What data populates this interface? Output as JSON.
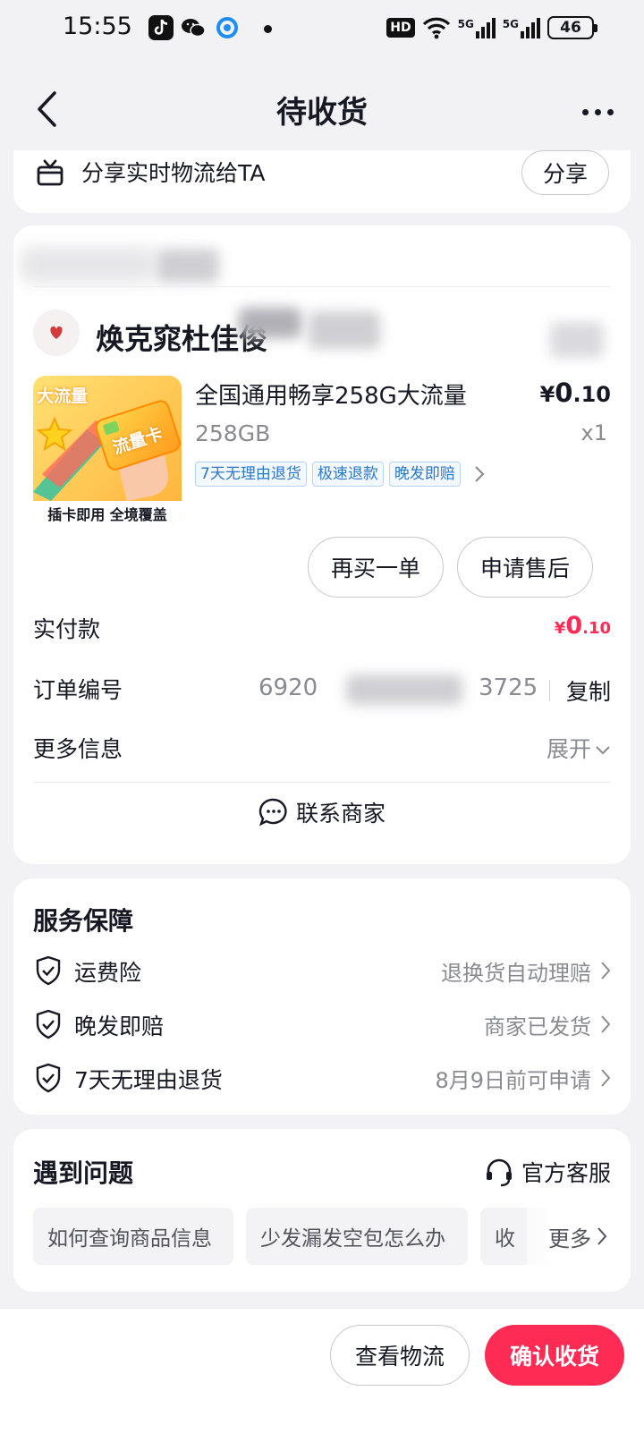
{
  "status_bar": {
    "time": "15:55",
    "apps": [
      "tiktok-icon",
      "wechat-icon",
      "browser-icon"
    ],
    "hd_label": "HD",
    "net1": "5G",
    "net2": "5G",
    "battery": "46"
  },
  "nav": {
    "title": "待收货"
  },
  "share": {
    "text": "分享实时物流给TA",
    "button": "分享"
  },
  "order": {
    "shop_name": "焕克窕杜佳俊",
    "product": {
      "image_top_text": "大流量",
      "image_card_text": "流量卡",
      "image_caption": "插卡即用 全境覆盖",
      "title": "全国通用畅享258G大流量",
      "price_symbol": "¥",
      "price_int": "0",
      "price_dec": ".10",
      "spec": "258GB",
      "qty": "x1",
      "tags": [
        "7天无理由退货",
        "极速退款",
        "晚发即赔"
      ]
    },
    "buttons": {
      "rebuy": "再买一单",
      "after_sale": "申请售后"
    },
    "paid": {
      "label": "实付款",
      "symbol": "¥",
      "int": "0",
      "dec": ".10"
    },
    "order_no": {
      "label": "订单编号",
      "prefix": "6920",
      "suffix": "3725",
      "copy": "复制"
    },
    "more_info": {
      "label": "更多信息",
      "value": "展开"
    },
    "contact": "联系商家"
  },
  "service": {
    "title": "服务保障",
    "items": [
      {
        "label": "运费险",
        "value": "退换货自动理赔"
      },
      {
        "label": "晚发即赔",
        "value": "商家已发货"
      },
      {
        "label": "7天无理由退货",
        "value": "8月9日前可申请"
      }
    ]
  },
  "problems": {
    "title": "遇到问题",
    "service_link": "官方客服",
    "chips": [
      "如何查询商品信息",
      "少发漏发空包怎么办",
      "收"
    ],
    "more": "更多"
  },
  "bottom": {
    "logistics": "查看物流",
    "confirm": "确认收货"
  },
  "colors": {
    "accent": "#fe2c55",
    "tag_blue": "#2b79c7",
    "background": "#f2f2f4"
  }
}
